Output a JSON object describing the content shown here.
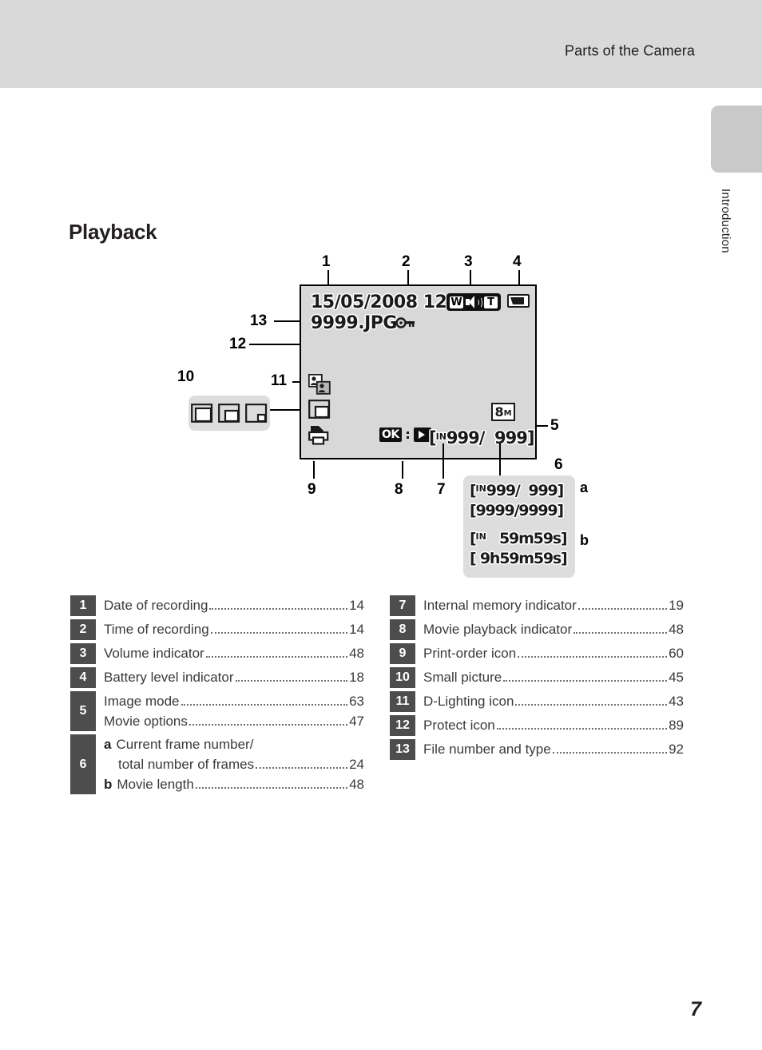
{
  "header": {
    "title": "Parts of the Camera"
  },
  "section_tab": {
    "label": "Introduction"
  },
  "page": {
    "heading": "Playback",
    "number": "7"
  },
  "lcd": {
    "datetime": "15/05/2008 12:00",
    "filename": "9999.JPG",
    "volume": {
      "wide_label": "W",
      "tele_label": "T",
      "speaker_icon": "speaker-icon"
    },
    "battery_icon": "battery-level-icon",
    "protect_icon": "protect-key-icon",
    "dlighting_icon": "d-lighting-icon",
    "smallpicture_icon": "small-picture-icon",
    "printorder_icon": "print-order-icon",
    "image_mode": {
      "value": "8",
      "unit": "M"
    },
    "ok_label": "OK",
    "movie_play_icon": "movie-playback-icon",
    "frame_counter": "999/  999]",
    "frame_counter_prefix": "[",
    "internal_memory_mark": "IN"
  },
  "callouts": {
    "numbers": [
      "1",
      "2",
      "3",
      "4",
      "5",
      "6",
      "7",
      "8",
      "9",
      "10",
      "11",
      "12",
      "13"
    ],
    "letters": [
      "a",
      "b"
    ]
  },
  "small_picture_callout": {
    "icons": [
      "small-picture-large-icon",
      "small-picture-medium-icon",
      "small-picture-small-icon"
    ]
  },
  "frames_callout": {
    "lines": [
      {
        "prefix": "[",
        "mem": "IN",
        "text": "999/  999]"
      },
      {
        "prefix": "[",
        "mem": "",
        "text": "9999/9999]"
      },
      {
        "prefix": "[",
        "mem": "IN",
        "text": "   59m59s]"
      },
      {
        "prefix": "[",
        "mem": "",
        "text": " 9h59m59s]"
      }
    ]
  },
  "index_left": [
    {
      "badge": "1",
      "entries": [
        {
          "text": "Date of recording",
          "page": "14"
        }
      ]
    },
    {
      "badge": "2",
      "entries": [
        {
          "text": "Time of recording",
          "page": "14"
        }
      ]
    },
    {
      "badge": "3",
      "entries": [
        {
          "text": "Volume indicator",
          "page": "48"
        }
      ]
    },
    {
      "badge": "4",
      "entries": [
        {
          "text": "Battery level indicator",
          "page": "18"
        }
      ]
    },
    {
      "badge": "5",
      "entries": [
        {
          "text": "Image mode",
          "page": "63"
        },
        {
          "text": "Movie options",
          "page": "47"
        }
      ]
    },
    {
      "badge": "6",
      "entries": [
        {
          "sub": "a",
          "text": "Current frame number/",
          "text2": "total number of frames",
          "page": "24"
        },
        {
          "sub": "b",
          "text": "Movie length",
          "page": "48"
        }
      ]
    }
  ],
  "index_right": [
    {
      "badge": "7",
      "entries": [
        {
          "text": "Internal memory indicator",
          "page": "19"
        }
      ]
    },
    {
      "badge": "8",
      "entries": [
        {
          "text": "Movie playback indicator",
          "page": "48"
        }
      ]
    },
    {
      "badge": "9",
      "entries": [
        {
          "text": "Print-order icon",
          "page": "60"
        }
      ]
    },
    {
      "badge": "10",
      "entries": [
        {
          "text": "Small picture",
          "page": "45"
        }
      ]
    },
    {
      "badge": "11",
      "entries": [
        {
          "text": "D-Lighting icon",
          "page": "43"
        }
      ]
    },
    {
      "badge": "12",
      "entries": [
        {
          "text": "Protect icon",
          "page": "89"
        }
      ]
    },
    {
      "badge": "13",
      "entries": [
        {
          "text": "File number and type",
          "page": "92"
        }
      ]
    }
  ],
  "colors": {
    "header_band": "#d9d9d9",
    "tab": "#c9c9c9",
    "badge": "#4d4d4d",
    "lcd": "#d8d8d8",
    "callout": "#dddddd"
  }
}
